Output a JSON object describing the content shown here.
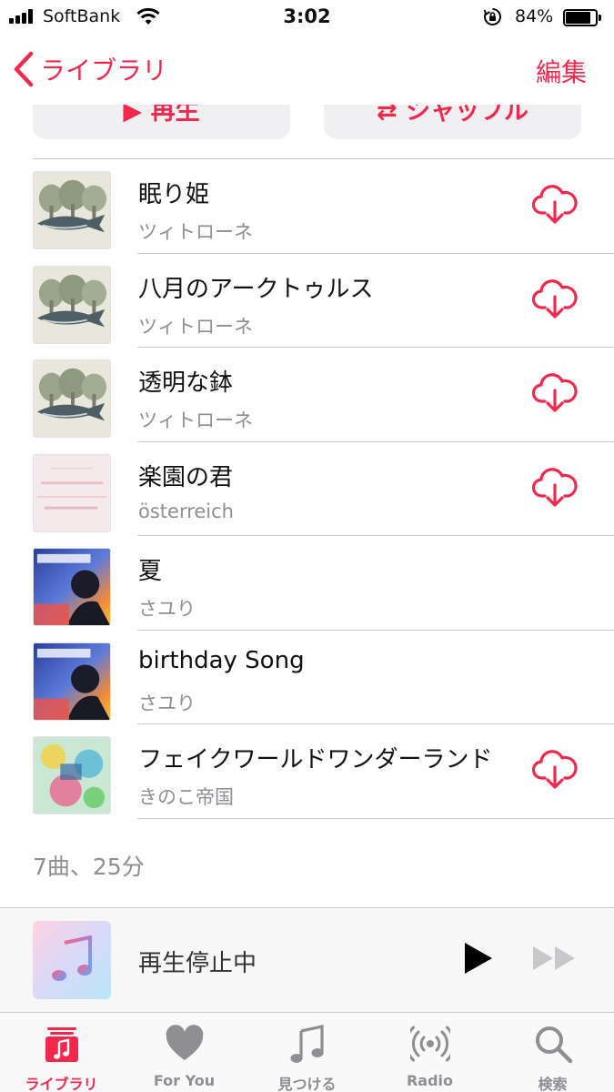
{
  "status_bar": {
    "carrier": "SoftBank",
    "time": "3:02",
    "battery_percent": "84%",
    "battery_level": 0.84
  },
  "nav": {
    "back_label": "ライブラリ",
    "edit_label": "編集"
  },
  "actions": {
    "play_label": "再生",
    "shuffle_label": "シャッフル"
  },
  "songs": [
    {
      "title": "眠り姫",
      "artist": "ツィトローネ",
      "downloadable": true,
      "artwork": "forest-whale"
    },
    {
      "title": "八月のアークトゥルス",
      "artist": "ツィトローネ",
      "downloadable": true,
      "artwork": "forest-whale"
    },
    {
      "title": "透明な鉢",
      "artist": "ツィトローネ",
      "downloadable": true,
      "artwork": "forest-whale"
    },
    {
      "title": "楽園の君",
      "artist": "österreich",
      "downloadable": true,
      "artwork": "pale-pink"
    },
    {
      "title": "夏",
      "artist": "さユり",
      "downloadable": false,
      "artwork": "sayuri"
    },
    {
      "title": "birthday Song",
      "artist": "さユり",
      "downloadable": false,
      "artwork": "sayuri"
    },
    {
      "title": "フェイクワールドワンダーランド",
      "artist": "きのこ帝国",
      "downloadable": true,
      "artwork": "colorful-collage"
    }
  ],
  "summary": "7曲、25分",
  "mini_player": {
    "status": "再生停止中"
  },
  "tabs": [
    {
      "label": "ライブラリ",
      "icon": "library-icon",
      "active": true
    },
    {
      "label": "For You",
      "icon": "heart-icon",
      "active": false
    },
    {
      "label": "見つける",
      "icon": "music-note-icon",
      "active": false
    },
    {
      "label": "Radio",
      "icon": "radio-icon",
      "active": false
    },
    {
      "label": "検索",
      "icon": "search-icon",
      "active": false
    }
  ],
  "colors": {
    "accent": "#f2284d",
    "secondary_text": "#8e8e93",
    "separator": "#c8c7cc"
  }
}
